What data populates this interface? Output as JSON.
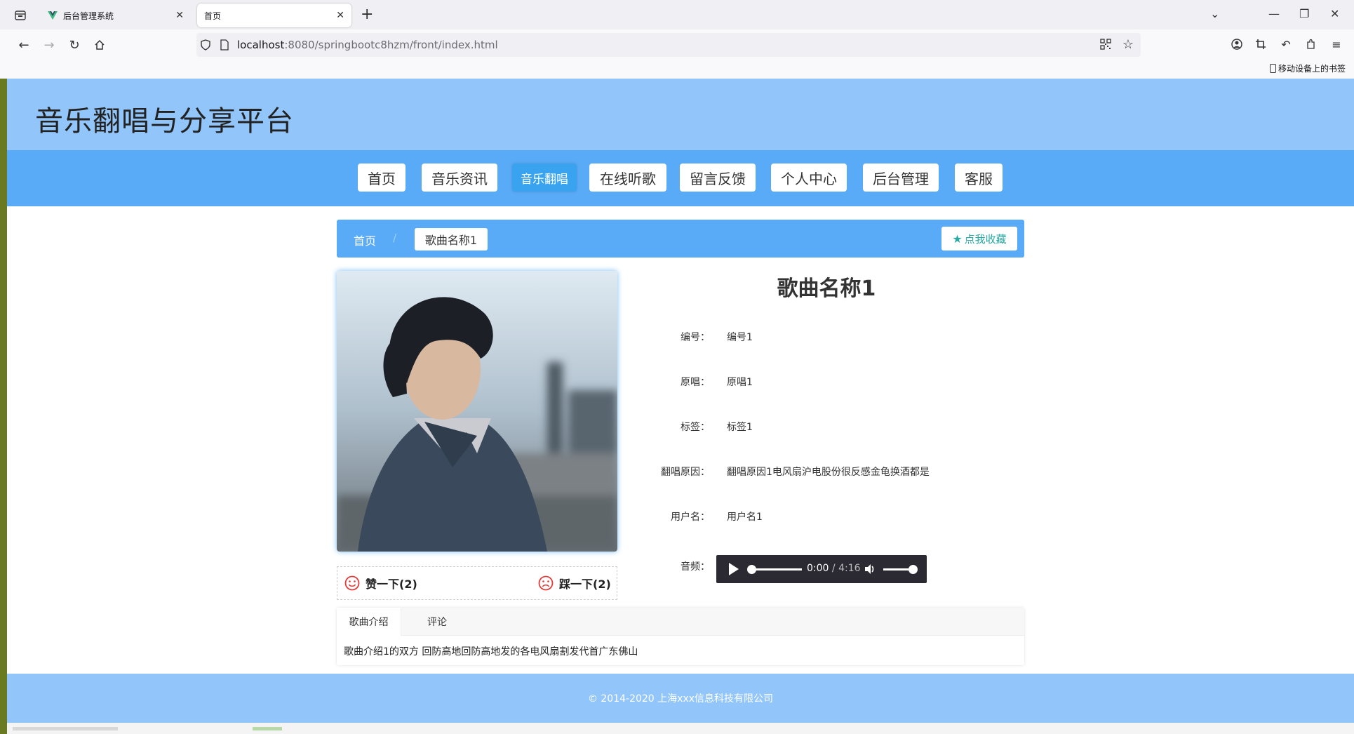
{
  "browser": {
    "tabs": [
      {
        "title": "后台管理系统",
        "active": false
      },
      {
        "title": "首页",
        "active": true
      }
    ],
    "url_host": "localhost",
    "url_path": ":8080/springbootc8hzm/front/index.html",
    "mobile_bookmarks": "移动设备上的书签"
  },
  "site": {
    "title": "音乐翻唱与分享平台",
    "nav": [
      "首页",
      "音乐资讯",
      "音乐翻唱",
      "在线听歌",
      "留言反馈",
      "个人中心",
      "后台管理",
      "客服"
    ],
    "nav_active_index": 2
  },
  "breadcrumb": {
    "home": "首页",
    "separator": "/",
    "current": "歌曲名称1",
    "favorite": "点我收藏"
  },
  "song": {
    "title": "歌曲名称1",
    "fields": [
      {
        "label": "编号：",
        "value": "编号1"
      },
      {
        "label": "原唱：",
        "value": "原唱1"
      },
      {
        "label": "标签：",
        "value": "标签1"
      },
      {
        "label": "翻唱原因：",
        "value": "翻唱原因1电风扇沪电股份很反感金龟换酒都是"
      },
      {
        "label": "用户名：",
        "value": "用户名1"
      }
    ],
    "audio_label": "音频：",
    "audio_current": "0:00",
    "audio_total": "/ 4:16",
    "like": "赞一下(2)",
    "dislike": "踩一下(2)"
  },
  "tabs": {
    "items": [
      "歌曲介绍",
      "评论"
    ],
    "active_index": 0,
    "content": "歌曲介绍1的双方 回防高地回防高地发的各电风扇割发代首广东佛山"
  },
  "footer": {
    "text": "© 2014-2020 上海xxx信息科技有限公司"
  },
  "colors": {
    "header": "#92c6fb",
    "nav": "#5aabf7",
    "active_nav": "#3aa3ef",
    "favorite": "#27aaa4"
  }
}
